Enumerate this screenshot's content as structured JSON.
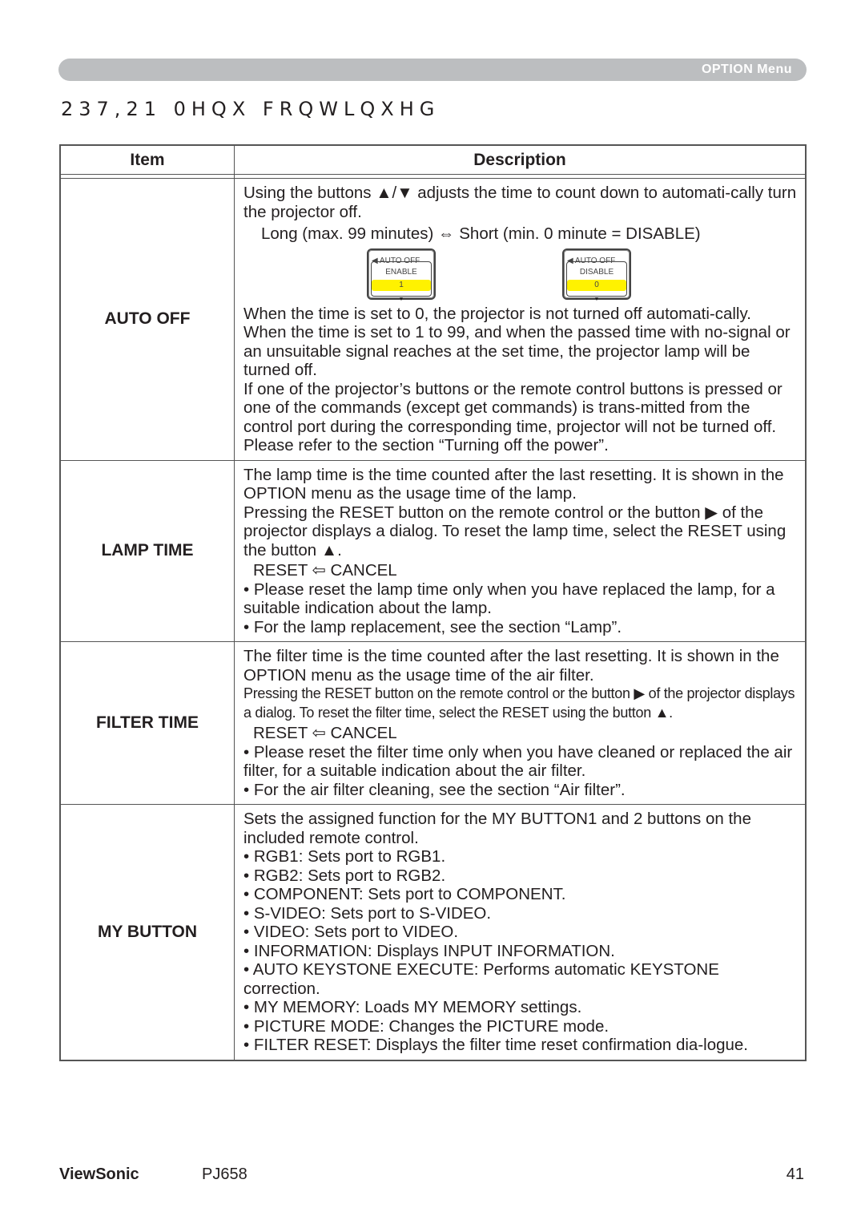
{
  "header": {
    "section_label": "OPTION Menu"
  },
  "page_title": "237,21 0HQX  FRQWLQXHG",
  "table": {
    "headers": {
      "item": "Item",
      "description": "Description"
    },
    "rows": [
      {
        "item": "AUTO OFF",
        "intro": "Using the buttons ▲/▼ adjusts the time to count down to automati-cally turn the projector off.",
        "range": "Long (max. 99 minutes) ⇔ Short (min. 0 minute = DISABLE)",
        "osd": [
          {
            "title": "AUTO OFF",
            "mode": "ENABLE",
            "value": "1"
          },
          {
            "title": "AUTO OFF",
            "mode": "DISABLE",
            "value": "0"
          }
        ],
        "paragraphs": [
          "When the time is set to 0, the projector is not turned off automati-cally.",
          "When the time is set to 1 to 99, and when the passed time with no-signal or an unsuitable signal reaches at the set time, the projector lamp will be turned off.",
          "If one of the projector’s buttons or the remote control buttons is pressed or one of the commands (except get commands) is trans-mitted from the control port during the corresponding time, projector will not be turned off.",
          "Please refer to the section “Turning off the power”."
        ]
      },
      {
        "item": "LAMP TIME",
        "intro": "The lamp time is the time counted after the last resetting. It is shown in the OPTION menu as the usage time of the lamp.",
        "instruction": "Pressing the RESET button on the remote control or the button ▶ of the projector displays a dialog. To reset the lamp time, select the RESET using the button ▲.",
        "dialog": "RESET ⇦ CANCEL",
        "bullets": [
          "• Please reset the lamp time only when you have replaced the lamp, for a suitable indication about the lamp.",
          "• For the lamp replacement, see the section “Lamp”."
        ]
      },
      {
        "item": "FILTER TIME",
        "intro": "The filter time is the time counted after the last resetting. It is shown in the OPTION menu as the usage time of the air filter.",
        "instruction": "Pressing the RESET button on the remote control or the button ▶ of the projector displays a dialog. To reset the filter time, select the RESET using the button ▲.",
        "dialog": "RESET ⇦ CANCEL",
        "bullets": [
          "• Please reset the filter time only when you have cleaned or replaced the air filter, for a suitable indication about the air filter.",
          "• For the air filter cleaning, see the section “Air filter”."
        ]
      },
      {
        "item": "MY BUTTON",
        "intro": "Sets the assigned function for the MY BUTTON1 and 2 buttons on the included remote control.",
        "bullets": [
          "• RGB1: Sets port to RGB1.",
          "• RGB2: Sets port to RGB2.",
          "• COMPONENT: Sets port to COMPONENT.",
          "• S-VIDEO: Sets port to S-VIDEO.",
          "• VIDEO: Sets port to VIDEO.",
          "• INFORMATION: Displays INPUT INFORMATION.",
          "• AUTO KEYSTONE EXECUTE: Performs automatic KEYSTONE correction.",
          "• MY MEMORY: Loads MY MEMORY settings.",
          "• PICTURE MODE: Changes the PICTURE mode.",
          "• FILTER RESET: Displays the filter time reset confirmation dia-logue."
        ]
      }
    ]
  },
  "footer": {
    "brand": "ViewSonic",
    "model": "PJ658",
    "page_number": "41"
  },
  "colors": {
    "header_bar": "#bcbec0",
    "osd_highlight": "#fff200",
    "text": "#231f20"
  }
}
